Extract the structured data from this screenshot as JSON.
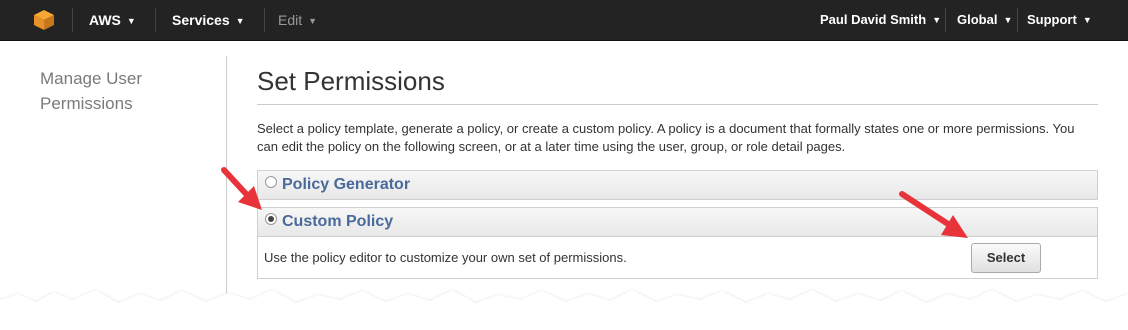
{
  "topbar": {
    "aws_label": "AWS",
    "services_label": "Services",
    "edit_label": "Edit",
    "user_label": "Paul David Smith",
    "region_label": "Global",
    "support_label": "Support"
  },
  "sidebar": {
    "title": "Manage User Permissions"
  },
  "main": {
    "title": "Set Permissions",
    "description": "Select a policy template, generate a policy, or create a custom policy. A policy is a document that formally states one or more permissions. You can edit the policy on the following screen, or at a later time using the user, group, or role detail pages.",
    "options": [
      {
        "label": "Policy Generator",
        "selected": false
      },
      {
        "label": "Custom Policy",
        "selected": true,
        "body": "Use the policy editor to customize your own set of permissions.",
        "button": "Select"
      }
    ]
  },
  "colors": {
    "topbar": "#232323",
    "panel_label": "#4a6a9a",
    "annotation_arrow": "#e8333a"
  },
  "icons": [
    "aws-cube-icon",
    "chevron-down-icon",
    "radio-icon",
    "arrow-annotation-icon"
  ]
}
